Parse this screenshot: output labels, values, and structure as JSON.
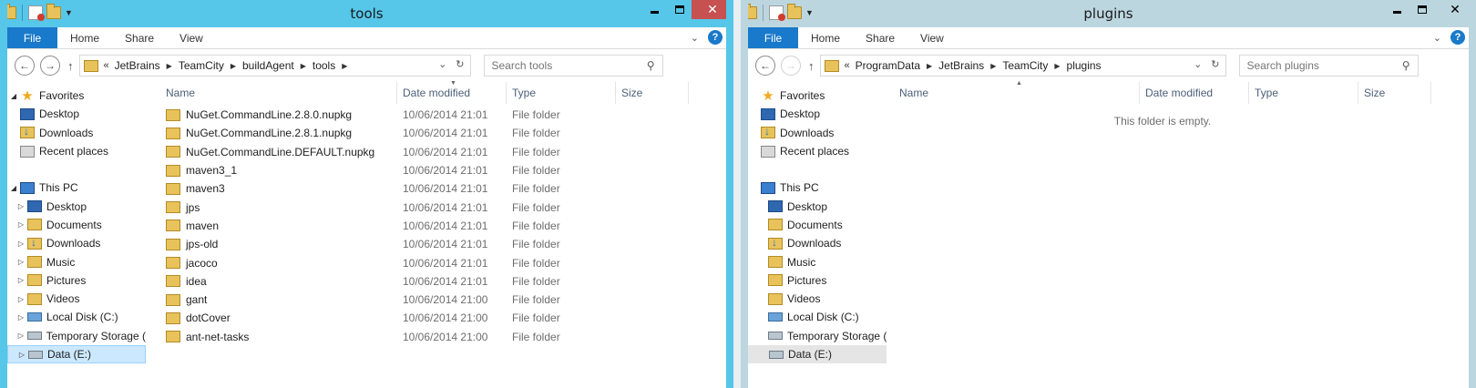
{
  "left": {
    "title": "tools",
    "ribbon": {
      "file": "File",
      "home": "Home",
      "share": "Share",
      "view": "View"
    },
    "address": {
      "lead": "«",
      "crumbs": [
        "JetBrains",
        "TeamCity",
        "buildAgent",
        "tools"
      ]
    },
    "search": {
      "placeholder": "Search tools"
    },
    "columns": {
      "name": "Name",
      "date": "Date modified",
      "type": "Type",
      "size": "Size"
    },
    "files": [
      {
        "name": "NuGet.CommandLine.2.8.0.nupkg",
        "date": "10/06/2014 21:01",
        "type": "File folder"
      },
      {
        "name": "NuGet.CommandLine.2.8.1.nupkg",
        "date": "10/06/2014 21:01",
        "type": "File folder"
      },
      {
        "name": "NuGet.CommandLine.DEFAULT.nupkg",
        "date": "10/06/2014 21:01",
        "type": "File folder"
      },
      {
        "name": "maven3_1",
        "date": "10/06/2014 21:01",
        "type": "File folder"
      },
      {
        "name": "maven3",
        "date": "10/06/2014 21:01",
        "type": "File folder"
      },
      {
        "name": "jps",
        "date": "10/06/2014 21:01",
        "type": "File folder"
      },
      {
        "name": "maven",
        "date": "10/06/2014 21:01",
        "type": "File folder"
      },
      {
        "name": "jps-old",
        "date": "10/06/2014 21:01",
        "type": "File folder"
      },
      {
        "name": "jacoco",
        "date": "10/06/2014 21:01",
        "type": "File folder"
      },
      {
        "name": "idea",
        "date": "10/06/2014 21:01",
        "type": "File folder"
      },
      {
        "name": "gant",
        "date": "10/06/2014 21:00",
        "type": "File folder"
      },
      {
        "name": "dotCover",
        "date": "10/06/2014 21:00",
        "type": "File folder"
      },
      {
        "name": "ant-net-tasks",
        "date": "10/06/2014 21:00",
        "type": "File folder"
      }
    ]
  },
  "right": {
    "title": "plugins",
    "ribbon": {
      "file": "File",
      "home": "Home",
      "share": "Share",
      "view": "View"
    },
    "address": {
      "lead": "«",
      "crumbs": [
        "ProgramData",
        "JetBrains",
        "TeamCity",
        "plugins"
      ]
    },
    "search": {
      "placeholder": "Search plugins"
    },
    "columns": {
      "name": "Name",
      "date": "Date modified",
      "type": "Type",
      "size": "Size"
    },
    "empty_message": "This folder is empty."
  },
  "nav": {
    "favorites": "Favorites",
    "fav_items": [
      "Desktop",
      "Downloads",
      "Recent places"
    ],
    "this_pc": "This PC",
    "pc_items": [
      "Desktop",
      "Documents",
      "Downloads",
      "Music",
      "Pictures",
      "Videos",
      "Local Disk (C:)",
      "Temporary Storage (",
      "Data (E:)"
    ]
  },
  "icons": {
    "favorites": "star-icon",
    "desktop": "desktop-icon",
    "folder": "folder-icon",
    "downloads": "downloads-icon",
    "recent": "recent-places-icon",
    "this_pc": "computer-icon",
    "drive": "drive-icon",
    "search": "search-icon",
    "refresh": "refresh-icon",
    "help": "help-icon"
  },
  "colors": {
    "active_titlebar": "#56c6e9",
    "inactive_titlebar": "#bcd6e0",
    "file_tab": "#1979ca",
    "close_button": "#c75050"
  }
}
